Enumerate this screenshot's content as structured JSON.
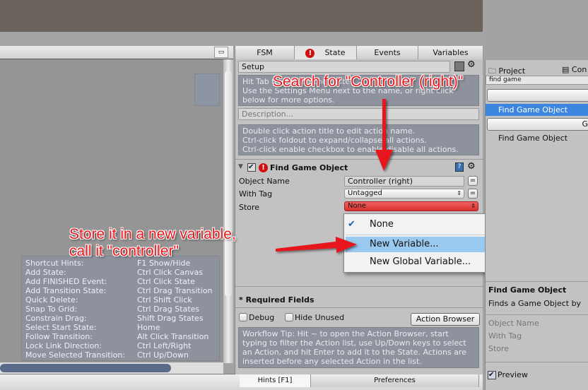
{
  "canvas": {
    "hints": [
      [
        "Shortcut Hints:",
        "F1 Show/Hide"
      ],
      [
        "Add State:",
        "Ctrl Click Canvas"
      ],
      [
        "Add FINISHED Event:",
        "Ctrl Click State"
      ],
      [
        "Add Transition State:",
        "Ctrl Drag Transition"
      ],
      [
        "Quick Delete:",
        "Ctrl Shift Click"
      ],
      [
        "Snap To Grid:",
        "Ctrl Drag States"
      ],
      [
        "Constrain Drag:",
        "Shift Drag States"
      ],
      [
        "Select Start State:",
        "Home"
      ],
      [
        "Follow Transition:",
        "Alt Click Transition"
      ],
      [
        "Lock Link Direction:",
        "Ctrl Left/Right"
      ],
      [
        "Move Selected Transition:",
        "Ctrl Up/Down"
      ]
    ]
  },
  "inspector": {
    "tabs": [
      "FSM",
      "State",
      "Events",
      "Variables"
    ],
    "state_name": "Setup",
    "state_hint": "Hit Tab to rename the State.\nUse the Settings Menu next to the name, or right click\nbelow for more options.",
    "description_placeholder": "Description...",
    "action_hint": "Double click action title to edit action name.\nCtrl-click foldout to expand/collapse all actions.\nCtrl-click enable checkbox to enable/disable all actions.",
    "action": {
      "title": "Find Game Object",
      "fields": [
        {
          "label": "Object Name",
          "value": "Controller (right)"
        },
        {
          "label": "With Tag",
          "value": "Untagged"
        },
        {
          "label": "Store",
          "value": "None"
        }
      ]
    },
    "dropdown": {
      "items": [
        "None",
        "New Variable...",
        "New Global Variable..."
      ],
      "checked": "None",
      "highlighted": "New Variable..."
    },
    "required": "* Required Fields",
    "debug": "Debug",
    "hide_unused": "Hide Unused",
    "action_browser": "Action Browser",
    "workflow_tip": "Workflow Tip: Hit ~ to open the Action Browser, start typing to filter the Action list, use Up/Down keys to select an Action, and hit Enter to add it to the State. Actions are inserted before any selected Action in the list.",
    "bottom_tabs": [
      "Hints [F1]",
      "Preferences"
    ]
  },
  "browser": {
    "tabs": [
      "Project",
      "Con"
    ],
    "search": "find game",
    "results": [
      "Find Game Object",
      "G",
      "Find Game Object"
    ],
    "title": "Find Game Object",
    "desc": "Finds a Game Object by",
    "params": [
      "Object Name",
      "With Tag",
      "Store"
    ],
    "preview": "Preview"
  },
  "annotations": {
    "search": "Search for \"Controller (right)\"",
    "store_1": "Store it in a new variable,",
    "store_2": "call it \"controller\""
  },
  "colors": {
    "accent": "#e8141a",
    "selection": "#3d86e0",
    "dropdown_highlight": "#99c9ef",
    "store_field": "#e04040"
  }
}
